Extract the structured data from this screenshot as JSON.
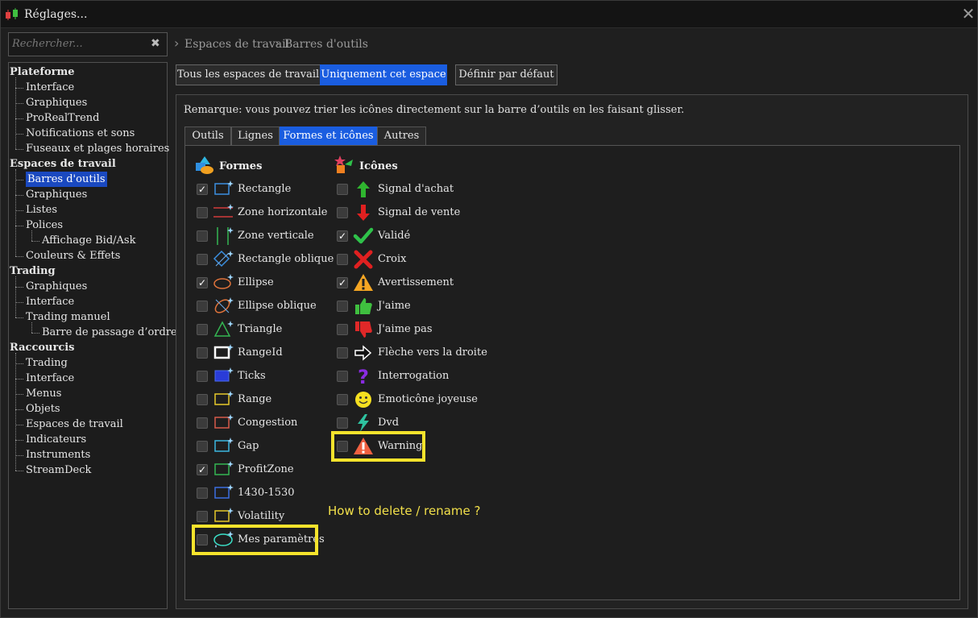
{
  "window": {
    "title": "Réglages...",
    "close_glyph": "✕"
  },
  "search": {
    "placeholder": "Rechercher...",
    "clear_glyph": "✖"
  },
  "tree": [
    {
      "label": "Plateforme",
      "level": 0
    },
    {
      "label": "Interface",
      "level": 1
    },
    {
      "label": "Graphiques",
      "level": 1
    },
    {
      "label": "ProRealTrend",
      "level": 1
    },
    {
      "label": "Notifications et sons",
      "level": 1
    },
    {
      "label": "Fuseaux et plages horaires",
      "level": 1
    },
    {
      "label": "Espaces de travail",
      "level": 0
    },
    {
      "label": "Barres d'outils",
      "level": 1,
      "selected": true
    },
    {
      "label": "Graphiques",
      "level": 1
    },
    {
      "label": "Listes",
      "level": 1
    },
    {
      "label": "Polices",
      "level": 1
    },
    {
      "label": "Affichage Bid/Ask",
      "level": 2
    },
    {
      "label": "Couleurs & Effets",
      "level": 1
    },
    {
      "label": "Trading",
      "level": 0
    },
    {
      "label": "Graphiques",
      "level": 1
    },
    {
      "label": "Interface",
      "level": 1
    },
    {
      "label": "Trading manuel",
      "level": 1
    },
    {
      "label": "Barre de passage d’ordres",
      "level": 2
    },
    {
      "label": "Raccourcis",
      "level": 0
    },
    {
      "label": "Trading",
      "level": 1
    },
    {
      "label": "Interface",
      "level": 1
    },
    {
      "label": "Menus",
      "level": 1
    },
    {
      "label": "Objets",
      "level": 1
    },
    {
      "label": "Espaces de travail",
      "level": 1
    },
    {
      "label": "Indicateurs",
      "level": 1
    },
    {
      "label": "Instruments",
      "level": 1
    },
    {
      "label": "StreamDeck",
      "level": 1
    }
  ],
  "breadcrumb": [
    "Espaces de travail",
    "Barres d'outils"
  ],
  "scope_buttons": [
    {
      "label": "Tous les espaces de travail",
      "active": false
    },
    {
      "label": "Uniquement cet espace",
      "active": true
    }
  ],
  "default_button": "Définir par défaut",
  "note": "Remarque: vous pouvez trier les icônes directement sur la barre d’outils en les faisant glisser.",
  "tabs": [
    {
      "label": "Outils",
      "active": false
    },
    {
      "label": "Lignes",
      "active": false
    },
    {
      "label": "Formes et icônes",
      "active": true
    },
    {
      "label": "Autres",
      "active": false
    }
  ],
  "formes": {
    "heading": "Formes",
    "items": [
      {
        "label": "Rectangle",
        "checked": true,
        "icon": "rectangle-icon",
        "color": "#3b8fe0"
      },
      {
        "label": "Zone horizontale",
        "checked": false,
        "icon": "horizontal-zone-icon",
        "color": "#d23b3b"
      },
      {
        "label": "Zone verticale",
        "checked": false,
        "icon": "vertical-zone-icon",
        "color": "#34b552"
      },
      {
        "label": "Rectangle oblique",
        "checked": false,
        "icon": "oblique-rectangle-icon",
        "color": "#3b8fe0"
      },
      {
        "label": "Ellipse",
        "checked": true,
        "icon": "ellipse-icon",
        "color": "#e0733b"
      },
      {
        "label": "Ellipse oblique",
        "checked": false,
        "icon": "oblique-ellipse-icon",
        "color": "#e0733b"
      },
      {
        "label": "Triangle",
        "checked": false,
        "icon": "triangle-icon",
        "color": "#34b552"
      },
      {
        "label": "RangeId",
        "checked": false,
        "icon": "rangeid-icon",
        "color": "#ffffff"
      },
      {
        "label": "Ticks",
        "checked": false,
        "icon": "ticks-icon",
        "color": "#2a3cd8"
      },
      {
        "label": "Range",
        "checked": false,
        "icon": "range-icon",
        "color": "#e6c82a"
      },
      {
        "label": "Congestion",
        "checked": false,
        "icon": "congestion-icon",
        "color": "#d65a4a"
      },
      {
        "label": "Gap",
        "checked": false,
        "icon": "gap-icon",
        "color": "#3bb7e0"
      },
      {
        "label": "ProfitZone",
        "checked": true,
        "icon": "profitzone-icon",
        "color": "#34b552"
      },
      {
        "label": "1430-1530",
        "checked": false,
        "icon": "time-range-icon",
        "color": "#3b6fe0"
      },
      {
        "label": "Volatility",
        "checked": false,
        "icon": "volatility-icon",
        "color": "#e6c82a"
      },
      {
        "label": "Mes paramètres",
        "checked": false,
        "icon": "custom-ellipse-icon",
        "color": "#3be0c8"
      }
    ]
  },
  "icones": {
    "heading": "Icônes",
    "items": [
      {
        "label": "Signal d'achat",
        "checked": false,
        "icon": "buy-arrow-icon",
        "color": "#2fb52f"
      },
      {
        "label": "Signal de vente",
        "checked": false,
        "icon": "sell-arrow-icon",
        "color": "#e02020"
      },
      {
        "label": "Validé",
        "checked": true,
        "icon": "checkmark-icon",
        "color": "#2fc24a"
      },
      {
        "label": "Croix",
        "checked": false,
        "icon": "cross-icon",
        "color": "#e02020"
      },
      {
        "label": "Avertissement",
        "checked": true,
        "icon": "warning-icon",
        "color": "#f5a623"
      },
      {
        "label": "J'aime",
        "checked": false,
        "icon": "thumbs-up-icon",
        "color": "#3fbf3f"
      },
      {
        "label": "J'aime pas",
        "checked": false,
        "icon": "thumbs-down-icon",
        "color": "#e02828"
      },
      {
        "label": "Flèche vers la droite",
        "checked": false,
        "icon": "right-arrow-icon",
        "color": "#ffffff"
      },
      {
        "label": "Interrogation",
        "checked": false,
        "icon": "question-icon",
        "color": "#8a2be2"
      },
      {
        "label": "Emoticône joyeuse",
        "checked": false,
        "icon": "smiley-icon",
        "color": "#f5e020"
      },
      {
        "label": "Dvd",
        "checked": false,
        "icon": "lightning-icon",
        "color": "#2ec2a0"
      },
      {
        "label": "Warning",
        "checked": false,
        "icon": "warning-red-icon",
        "color": "#f06040"
      }
    ]
  },
  "annotation": "How to delete / rename ?",
  "colors": {
    "accent": "#1a5de0",
    "highlight": "#f5e32c",
    "annotation": "#f2e04a"
  }
}
